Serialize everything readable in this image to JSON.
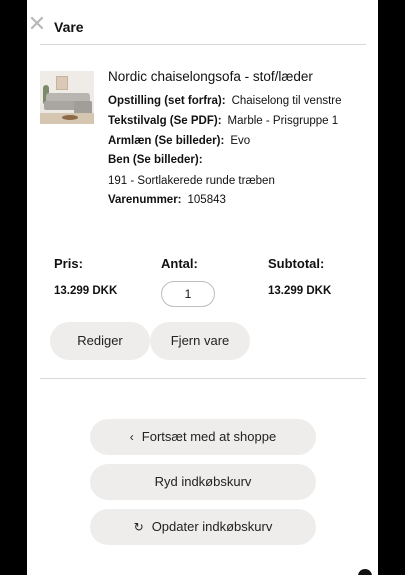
{
  "header": {
    "title": "Vare",
    "close_icon": "close-icon"
  },
  "product": {
    "name": "Nordic chaiselongsofa - stof/læder",
    "specs": [
      {
        "label": "Opstilling (set forfra):",
        "value": "Chaiselong til venstre"
      },
      {
        "label": "Tekstilvalg (Se PDF):",
        "value": "Marble - Prisgruppe 1"
      },
      {
        "label": "Armlæn (Se billeder):",
        "value": "Evo"
      },
      {
        "label": "Ben (Se billeder):",
        "value": ""
      }
    ],
    "ben_value": "191 - Sortlakerede runde træben",
    "varenummer": {
      "label": "Varenummer:",
      "value": "105843"
    }
  },
  "pricing": {
    "price_label": "Pris:",
    "qty_label": "Antal:",
    "subtotal_label": "Subtotal:",
    "price": "13.299 DKK",
    "quantity": "1",
    "subtotal": "13.299 DKK"
  },
  "item_actions": {
    "edit": "Rediger",
    "remove": "Fjern vare"
  },
  "cart_actions": {
    "continue": "Fortsæt med at shoppe",
    "continue_icon": "chevron-left-icon",
    "clear": "Ryd indkøbskurv",
    "update": "Opdater indkøbskurv",
    "update_icon": "refresh-icon"
  }
}
